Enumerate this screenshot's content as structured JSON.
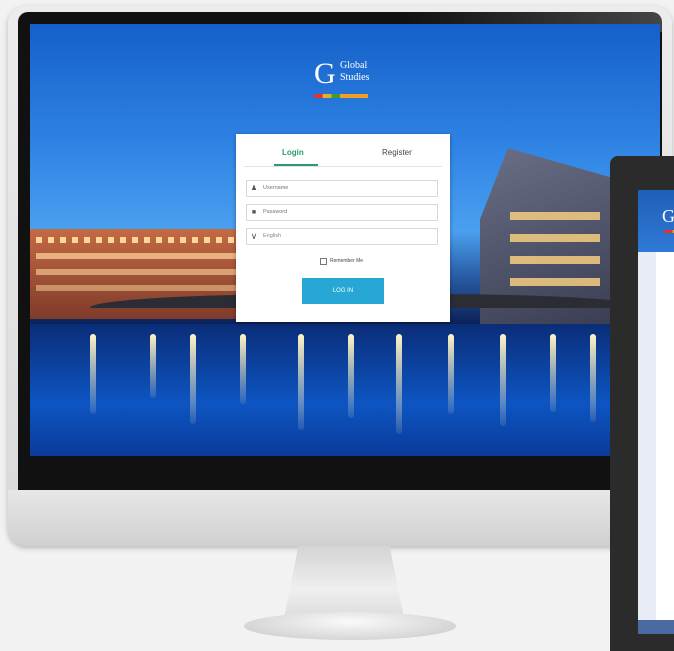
{
  "brand": {
    "logo_mark": "G",
    "name_line1": "Global",
    "name_line2": "Studies"
  },
  "login_card": {
    "tabs": [
      {
        "label": "Login",
        "active": true
      },
      {
        "label": "Register",
        "active": false
      }
    ],
    "username": {
      "placeholder": "Username",
      "icon": "user-icon"
    },
    "password": {
      "placeholder": "Password",
      "icon": "lock-icon"
    },
    "language": {
      "value": "English",
      "icon": "chevron-down-icon"
    },
    "remember_me": {
      "label": "Remember Me",
      "checked": false
    },
    "submit_label": "LOG IN"
  },
  "colors": {
    "accent_green": "#2a9a6a",
    "button_blue": "#27a7d6"
  },
  "laptop": {
    "logo_mark": "G"
  }
}
